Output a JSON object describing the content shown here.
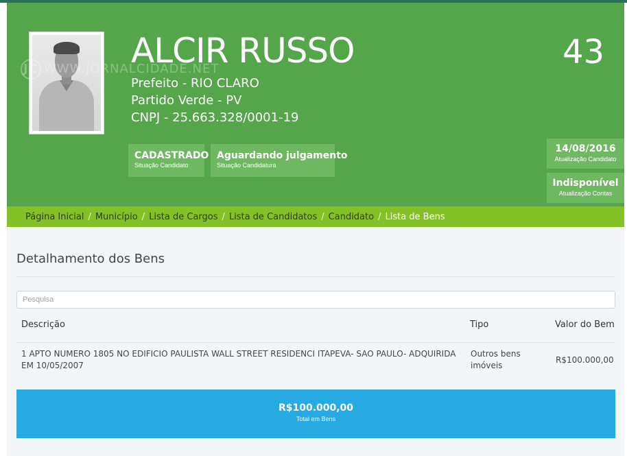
{
  "candidate": {
    "name": "ALCIR RUSSO",
    "number": "43",
    "office_line": "Prefeito - RIO CLARO",
    "party_line": "Partido Verde - PV",
    "cnpj_line": "CNPJ - 25.663.328/0001-19"
  },
  "watermark": {
    "logo": "JC",
    "text": "WWW.JORNALCIDADE.NET"
  },
  "status": [
    {
      "value": "CADASTRADO",
      "label": "Situação Candidato"
    },
    {
      "value": "Aguardando julgamento",
      "label": "Situação Candidatura"
    }
  ],
  "side": [
    {
      "value": "14/08/2016",
      "label": "Atualização Candidato"
    },
    {
      "value": "Indisponível",
      "label": "Atualização Contas"
    }
  ],
  "breadcrumb": {
    "items": [
      "Página Inicial",
      "Município",
      "Lista de Cargos",
      "Lista de Candidatos",
      "Candidato"
    ],
    "current": "Lista de Bens",
    "separator": "/"
  },
  "main": {
    "title": "Detalhamento dos Bens",
    "search_placeholder": "Pesquisa",
    "columns": [
      "Descrição",
      "Tipo",
      "Valor do Bem"
    ],
    "rows": [
      {
        "descricao": "1 APTO NUMERO 1805 NO EDIFICIO PAULISTA WALL STREET RESIDENCI ITAPEVA- SAO PAULO- ADQUIRIDA EM 10/05/2007",
        "tipo": "Outros bens imóveis",
        "valor": "R$100.000,00"
      }
    ],
    "total_value": "R$100.000,00",
    "total_label": "Total em Bens"
  },
  "colors": {
    "header_green": "#55a54b",
    "breadcrumb_green": "#85c126",
    "total_blue": "#27aae1"
  }
}
